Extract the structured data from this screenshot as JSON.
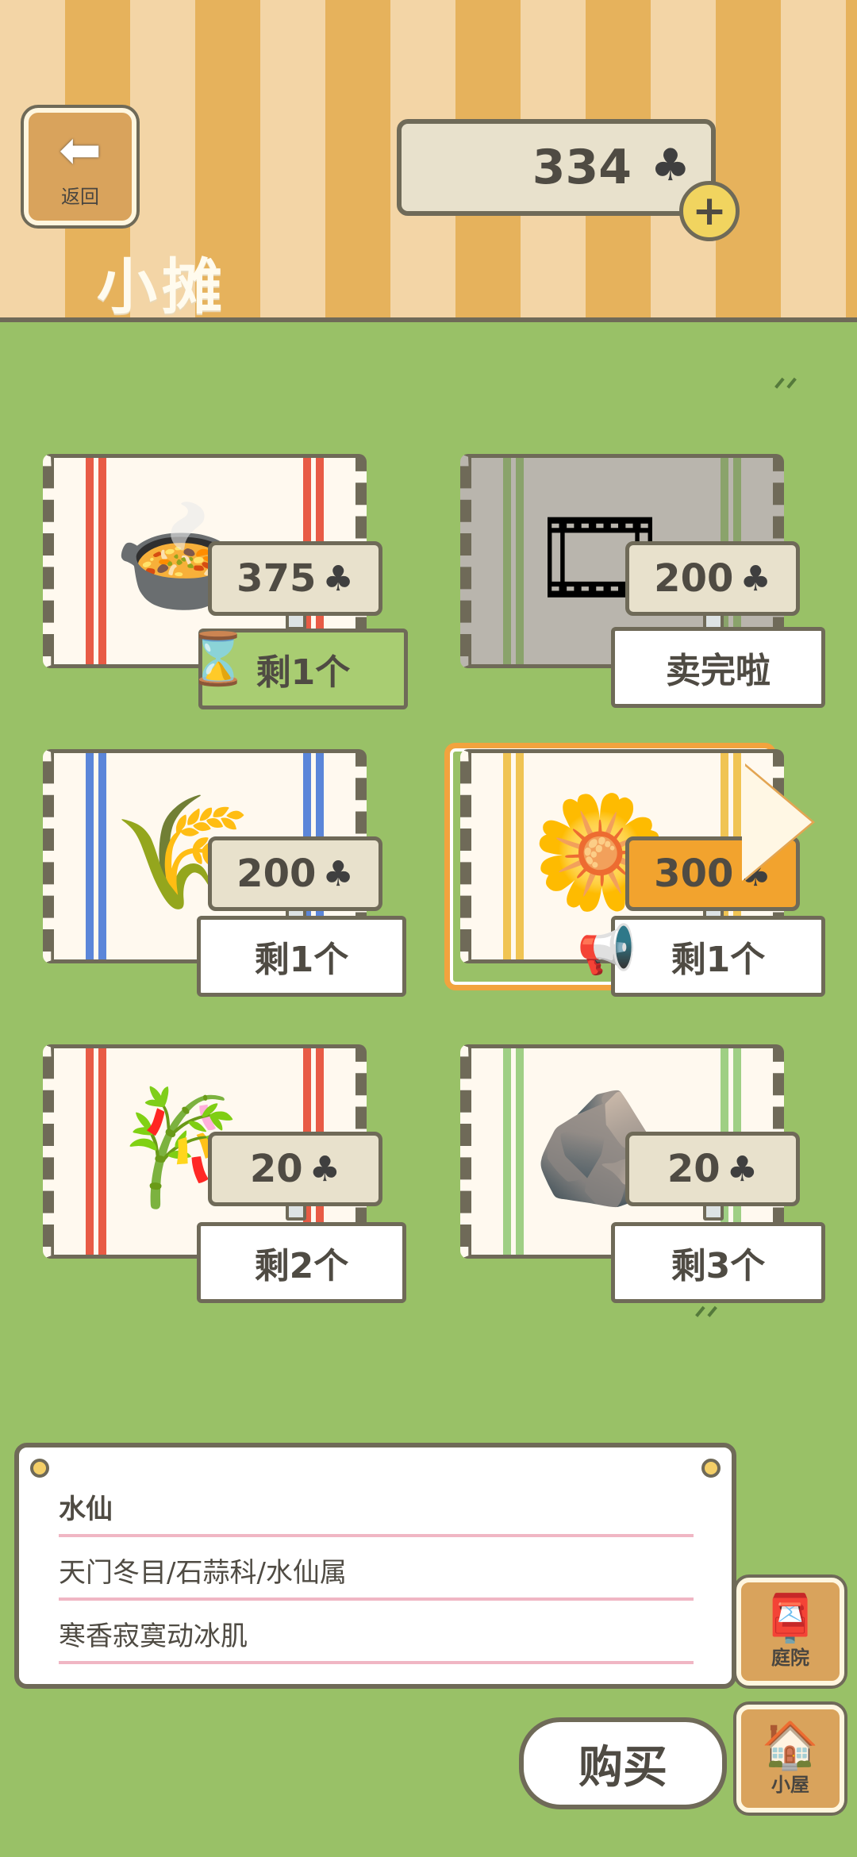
{
  "header": {
    "back_label": "返回",
    "title": "小摊",
    "currency_amount": "334",
    "currency_icon": "clover-icon",
    "plus_symbol": "+"
  },
  "items": [
    {
      "name": "soup-bowl",
      "price": "375",
      "stock": "剩1个",
      "art": "🍲",
      "rug_color": "#e85b45",
      "stock_style": "timed"
    },
    {
      "name": "ribbon-spool",
      "price": "200",
      "stock": "卖完啦",
      "art": "🎞",
      "rug_color": "#8aa36b",
      "stock_style": "soldout"
    },
    {
      "name": "grain-bundle",
      "price": "200",
      "stock": "剩1个",
      "art": "🌾",
      "rug_color": "#5b86d9",
      "stock_style": "normal"
    },
    {
      "name": "narcissus",
      "price": "300",
      "stock": "剩1个",
      "art": "🌼",
      "rug_color": "#f0c453",
      "stock_style": "featured"
    },
    {
      "name": "bamboo",
      "price": "20",
      "stock": "剩2个",
      "art": "🎋",
      "rug_color": "#e85b45",
      "stock_style": "normal"
    },
    {
      "name": "stones",
      "price": "20",
      "stock": "剩3个",
      "art": "🪨",
      "rug_color": "#9fcf84",
      "stock_style": "normal"
    }
  ],
  "selected_item": {
    "name": "水仙",
    "classification": "天门冬目/石蒜科/水仙属",
    "description": "寒香寂寞动冰肌"
  },
  "side_buttons": {
    "yard_label": "庭院",
    "house_label": "小屋"
  },
  "buy_label": "购买",
  "clover_symbol": "♣"
}
